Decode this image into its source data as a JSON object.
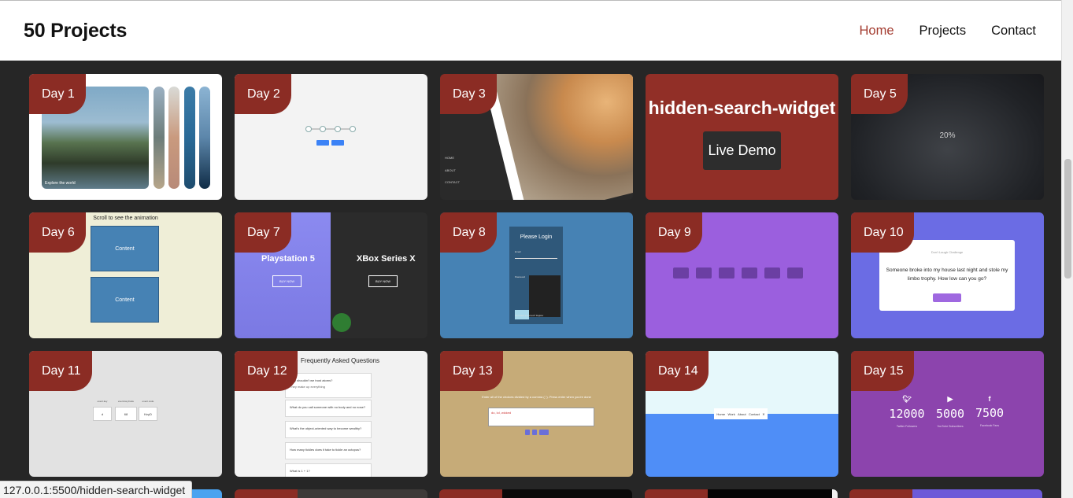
{
  "navbar": {
    "brand": "50 Projects",
    "links": [
      {
        "label": "Home",
        "active": true
      },
      {
        "label": "Projects",
        "active": false
      },
      {
        "label": "Contact",
        "active": false
      }
    ]
  },
  "colors": {
    "accent": "#a33b2f",
    "badge": "#8b2c24",
    "background": "#262626"
  },
  "cards": [
    {
      "day": "Day 1",
      "caption": "Explore the world"
    },
    {
      "day": "Day 2",
      "buttons": [
        "Prev",
        "Next"
      ]
    },
    {
      "day": "Day 3",
      "menu": [
        "HOME",
        "ABOUT",
        "CONTACT"
      ]
    },
    {
      "title": "hidden-search-widget",
      "button": "Live Demo"
    },
    {
      "day": "Day 5",
      "percent": "20%"
    },
    {
      "day": "Day 6",
      "header": "Scroll to see the animation",
      "box1": "Content",
      "box2": "Content"
    },
    {
      "day": "Day 7",
      "left_title": "Playstation 5",
      "right_title": "XBox Series X",
      "buy": "BUY NOW"
    },
    {
      "day": "Day 8",
      "title": "Please Login",
      "email": "Email",
      "password": "Password",
      "footer": "Don't have an account? Register"
    },
    {
      "day": "Day 9",
      "chips": [
        "applause",
        "boo",
        "gasp",
        "tada",
        "victory",
        "wrong"
      ]
    },
    {
      "day": "Day 10",
      "header": "Don't Laugh Challenge",
      "joke": "Someone broke into my house last night and stole my limbo trophy. How low can you go?",
      "button": "Get Another Joke"
    },
    {
      "day": "Day 11",
      "labels": [
        "event.key",
        "event.keyCode",
        "event.code"
      ],
      "values": [
        "d",
        "68",
        "KeyD"
      ]
    },
    {
      "day": "Day 12",
      "title": "Frequently Asked Questions",
      "questions": [
        "Why shouldn't we trust atoms?",
        "They make up everything",
        "What do you call someone with no body and no nose?",
        "What's the object-oriented way to become wealthy?",
        "How many tickles does it take to tickle an octopus?",
        "What is 1 + 1?"
      ]
    },
    {
      "day": "Day 13",
      "prompt": "Enter all of the choices divided by a comma (','). Press enter when you're done",
      "input": "do, lol, wicked",
      "tags": [
        "do",
        "lol",
        "wicked"
      ]
    },
    {
      "day": "Day 14",
      "nav": [
        "Home",
        "Work",
        "About",
        "Contact"
      ]
    },
    {
      "day": "Day 15",
      "counters": [
        {
          "icon": "twitter-icon",
          "value": "12000",
          "label": "Twitter Followers"
        },
        {
          "icon": "youtube-icon",
          "value": "5000",
          "label": "YouTube Subscribers"
        },
        {
          "icon": "facebook-icon",
          "value": "7500",
          "label": "Facebook Fans"
        }
      ]
    }
  ],
  "status_bar": {
    "url": "127.0.0.1:5500/hidden-search-widget"
  }
}
